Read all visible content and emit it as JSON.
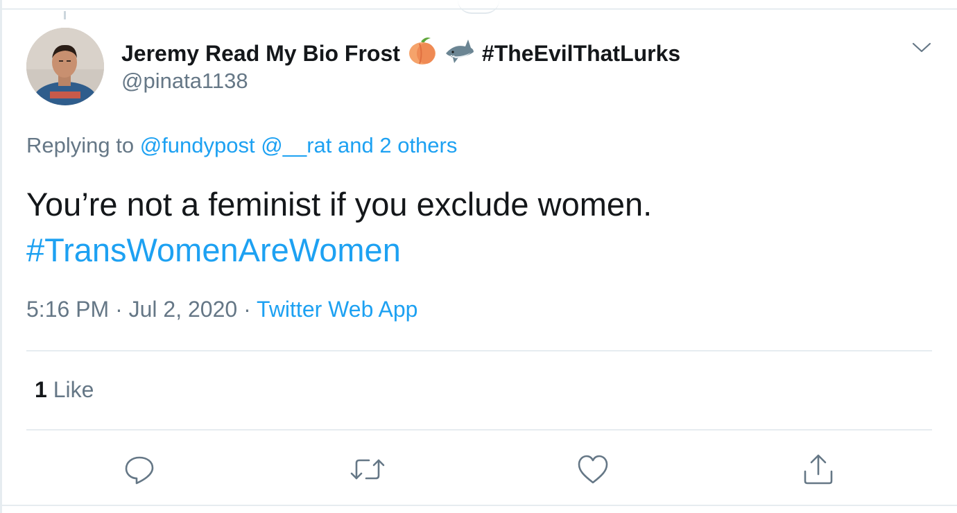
{
  "tweet": {
    "author": {
      "name": "Jeremy Read My Bio Frost",
      "name_emojis": [
        "peach-emoji",
        "shark-emoji"
      ],
      "name_hashtag": "#TheEvilThatLurks",
      "handle": "@pinata1138"
    },
    "reply": {
      "prefix": "Replying to",
      "mention_1": "@fundypost",
      "mention_2": "@__rat",
      "others": "and 2 others"
    },
    "text": "You’re not a feminist if you exclude women.",
    "hashtag": "#TransWomenAreWomen",
    "time": "5:16 PM",
    "separator": "·",
    "date": "Jul 2, 2020",
    "source": "Twitter Web App",
    "likes": {
      "count": "1",
      "label": "Like"
    },
    "actions": [
      "reply-icon",
      "retweet-icon",
      "like-icon",
      "share-icon"
    ]
  },
  "colors": {
    "link": "#1da1f2",
    "secondary_text": "#657786",
    "primary_text": "#14171a",
    "divider": "#e6ecf0"
  }
}
